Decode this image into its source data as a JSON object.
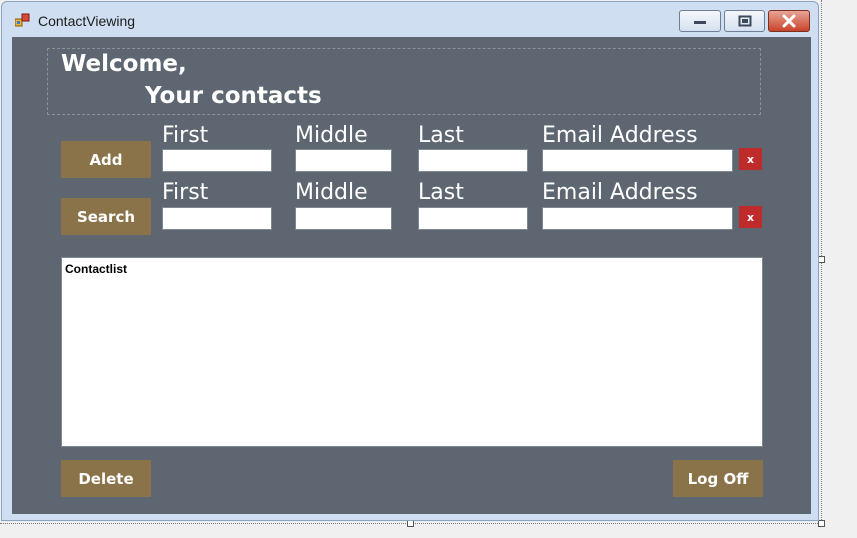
{
  "window": {
    "title": "ContactViewing"
  },
  "header": {
    "welcome": "Welcome,",
    "subtitle": "Your contacts"
  },
  "add_row": {
    "button": "Add",
    "labels": {
      "first": "First",
      "middle": "Middle",
      "last": "Last",
      "email": "Email Address"
    },
    "values": {
      "first": "",
      "middle": "",
      "last": "",
      "email": ""
    },
    "clear": "x"
  },
  "search_row": {
    "button": "Search",
    "labels": {
      "first": "First",
      "middle": "Middle",
      "last": "Last",
      "email": "Email Address"
    },
    "values": {
      "first": "",
      "middle": "",
      "last": "",
      "email": ""
    },
    "clear": "x"
  },
  "contact_list": {
    "label": "Contactlist"
  },
  "footer": {
    "delete": "Delete",
    "logoff": "Log Off"
  },
  "colors": {
    "client_bg": "#5e6771",
    "button_bg": "#8a7249",
    "clear_bg": "#bf2b2b"
  }
}
